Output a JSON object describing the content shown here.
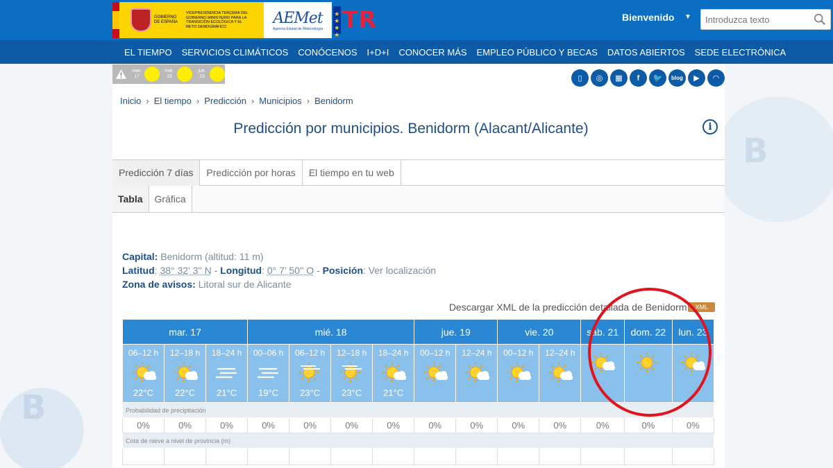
{
  "header": {
    "gov_text_1": "GOBIERNO DE ESPAÑA",
    "gov_text_2": "VICEPRESIDENCIA TERCERA DEL GOBIERNO MINISTERIO PARA LA TRANSICIÓN ECOLÓGICA Y EL RETO DEMOGRÁFICO",
    "aemet_word": "AEMet",
    "aemet_sub": "Agencia Estatal de Meteorología",
    "prtr": "TR",
    "welcome": "Bienvenido",
    "search_placeholder": "Introduzca texto"
  },
  "nav": [
    "EL TIEMPO",
    "SERVICIOS CLIMÁTICOS",
    "CONÓCENOS",
    "I+D+I",
    "CONOCER MÁS",
    "EMPLEO PÚBLICO Y BECAS",
    "DATOS ABIERTOS",
    "SEDE ELECTRÓNICA"
  ],
  "alerts": [
    {
      "day": "mar.",
      "num": "17"
    },
    {
      "day": "mié.",
      "num": "18"
    },
    {
      "day": "jue.",
      "num": "19"
    }
  ],
  "social": [
    "blog"
  ],
  "breadcrumb": [
    "Inicio",
    "El tiempo",
    "Predicción",
    "Municipios",
    "Benidorm"
  ],
  "title": "Predicción por municipios. Benidorm (Alacant/Alicante)",
  "info_icon": "i",
  "tabs": [
    "Predicción 7 días",
    "Predicción por horas",
    "El tiempo en tu web"
  ],
  "subtabs": [
    "Tabla",
    "Gráfica"
  ],
  "info": {
    "capital_label": "Capital:",
    "capital_value": "Benidorm (altitud: 11 m)",
    "lat_label": "Latitud",
    "lat_value": "38° 32' 3'' N",
    "lon_label": "Longitud",
    "lon_value": "0° 7' 50'' O",
    "pos_label": "Posición",
    "pos_value": "Ver localización",
    "zone_label": "Zona de avisos:",
    "zone_value": "Litoral sur de Alicante"
  },
  "xml": {
    "text": "Descargar XML de la predicción detallada de Benidorm",
    "badge": "XML"
  },
  "days": [
    {
      "label": "mar. 17",
      "span": 3
    },
    {
      "label": "mié. 18",
      "span": 4
    },
    {
      "label": "jue. 19",
      "span": 2
    },
    {
      "label": "vie. 20",
      "span": 2
    },
    {
      "label": "sáb. 21",
      "span": 1
    },
    {
      "label": "dom. 22",
      "span": 1
    },
    {
      "label": "lun. 23",
      "span": 1
    }
  ],
  "slots": [
    {
      "h": "06–12 h",
      "icon": "sun-cloud-icon",
      "t": "22°C"
    },
    {
      "h": "12–18 h",
      "icon": "sun-cloud-icon",
      "t": "22°C"
    },
    {
      "h": "18–24 h",
      "icon": "fog-icon",
      "t": "21°C"
    },
    {
      "h": "00–06 h",
      "icon": "fog-icon",
      "t": "19°C"
    },
    {
      "h": "06–12 h",
      "icon": "sun-haze-icon",
      "t": "23°C"
    },
    {
      "h": "12–18 h",
      "icon": "sun-haze-icon",
      "t": "23°C"
    },
    {
      "h": "18–24 h",
      "icon": "sun-cloud-icon",
      "t": "21°C"
    },
    {
      "h": "00–12 h",
      "icon": "sun-cloud-icon",
      "t": ""
    },
    {
      "h": "12–24 h",
      "icon": "sun-cloud-icon",
      "t": ""
    },
    {
      "h": "00–12 h",
      "icon": "sun-cloud-icon",
      "t": ""
    },
    {
      "h": "12–24 h",
      "icon": "sun-cloud-icon",
      "t": ""
    },
    {
      "h": "",
      "icon": "sun-cloud-icon",
      "t": ""
    },
    {
      "h": "",
      "icon": "sun-icon",
      "t": ""
    },
    {
      "h": "",
      "icon": "sun-cloud-icon",
      "t": ""
    }
  ],
  "precip_label": "Probabilidad de precipitación",
  "precip": [
    "0%",
    "0%",
    "0%",
    "0%",
    "0%",
    "0%",
    "0%",
    "0%",
    "0%",
    "0%",
    "0%",
    "0%",
    "0%",
    "0%"
  ],
  "snow_label": "Cota de nieve a nivel de provincia (m)",
  "colors": {
    "header": "#0a6fc2",
    "nav": "#0d5aa7",
    "day_header": "#2a87d3",
    "slot": "#89c0ec",
    "highlight_circle": "#e0141e"
  }
}
